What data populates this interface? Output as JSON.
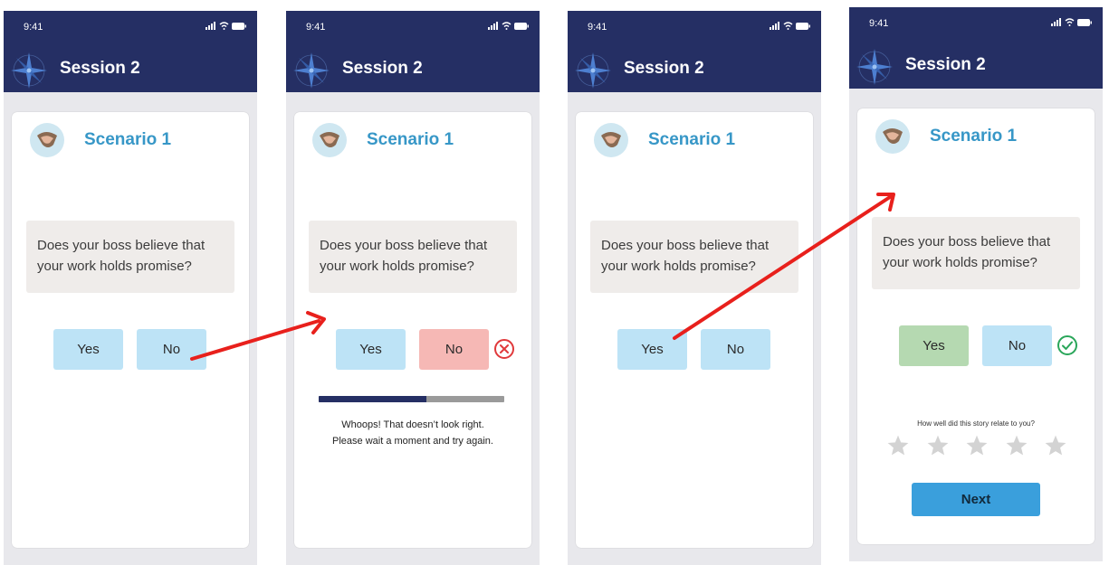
{
  "screens": [
    {
      "status_time": "9:41",
      "header_title": "Session 2",
      "scenario_title": "Scenario 1",
      "question": "Does your boss believe that your work holds promise?",
      "yes_label": "Yes",
      "no_label": "No"
    },
    {
      "status_time": "9:41",
      "header_title": "Session 2",
      "scenario_title": "Scenario 1",
      "question": "Does your boss believe that your work holds promise?",
      "yes_label": "Yes",
      "no_label": "No",
      "selected": "no",
      "result_icon": "error-circle-icon",
      "wait_progress": 0.58,
      "error_line1": "Whoops! That doesn’t look right.",
      "error_line2": "Please wait a moment and try again."
    },
    {
      "status_time": "9:41",
      "header_title": "Session 2",
      "scenario_title": "Scenario 1",
      "question": "Does your boss believe that your work holds promise?",
      "yes_label": "Yes",
      "no_label": "No"
    },
    {
      "status_time": "9:41",
      "header_title": "Session 2",
      "scenario_title": "Scenario 1",
      "question": "Does your boss believe that your work holds promise?",
      "yes_label": "Yes",
      "no_label": "No",
      "selected": "yes",
      "result_icon": "check-circle-icon",
      "rating_prompt": "How well did this story relate to you?",
      "rating_max": 5,
      "rating_value": 0,
      "next_label": "Next"
    }
  ],
  "colors": {
    "header_bg": "#252f64",
    "accent": "#3797c7",
    "button_bg": "#bde3f6",
    "wrong_bg": "#f6b8b5",
    "correct_bg": "#b5d9b1",
    "error_red": "#e0393b",
    "success_green": "#2aa65a",
    "next_bg": "#3a9fdc",
    "flow_arrow": "#e8201c"
  }
}
